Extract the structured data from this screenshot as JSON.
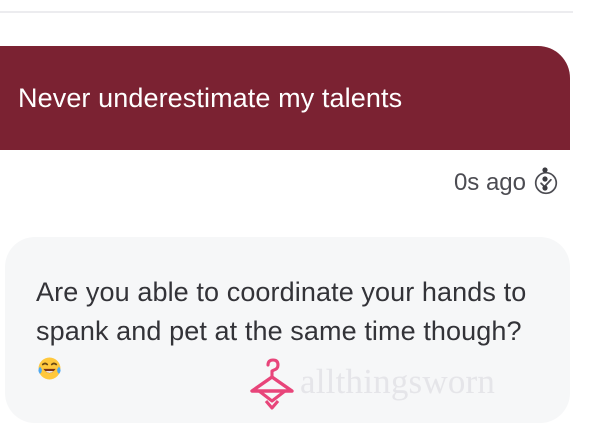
{
  "sent_message": {
    "text": "Never underestimate my talents",
    "timestamp": "0s ago",
    "status_icon": "check-circle-icon",
    "menu_icon": "more-vertical-icon"
  },
  "received_message": {
    "text": "Are you able to coordinate your hands to spank and pet at the same time though?",
    "emoji": "😂"
  },
  "watermark": {
    "text": "allthingsworn"
  },
  "colors": {
    "sent_bubble": "#7b2232",
    "received_bubble": "#f6f7f8",
    "watermark_logo": "#e8457a"
  }
}
